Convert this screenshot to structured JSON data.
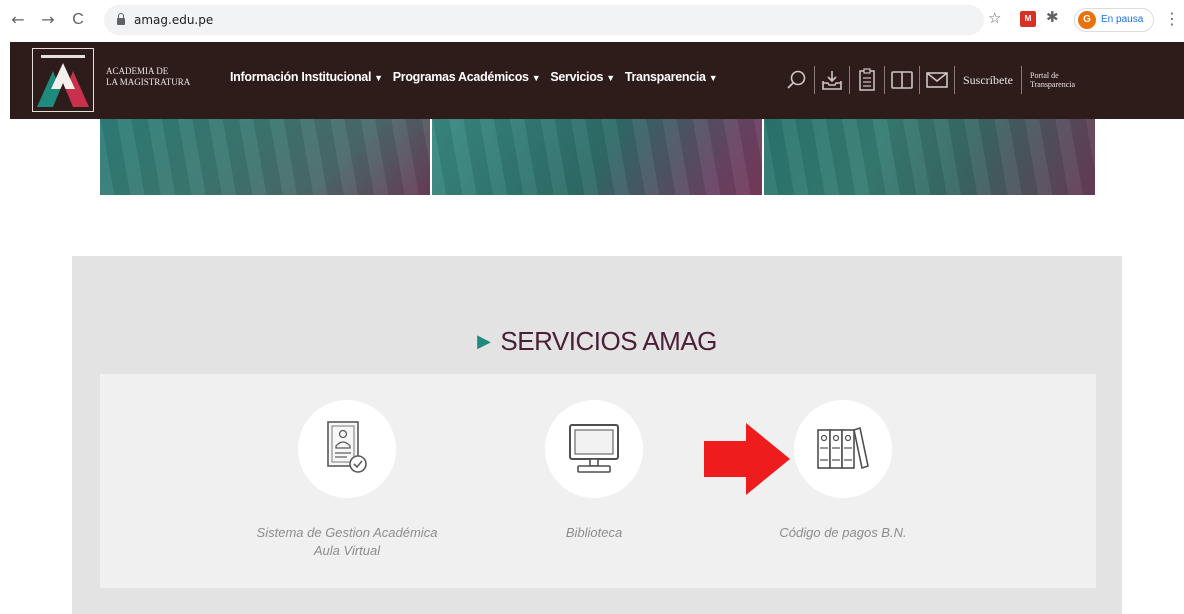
{
  "browser": {
    "url": "amag.edu.pe",
    "back_icon": "←",
    "forward_icon": "→",
    "reload_icon": "C",
    "profile_label": "En pausa",
    "profile_initial": "G",
    "extension_label": "M",
    "menu_icon": "⋮"
  },
  "header": {
    "logo_line1": "ACADEMIA DE",
    "logo_line2": "LA MAGISTRATURA",
    "nav": [
      {
        "label": "Información Institucional"
      },
      {
        "label": "Programas Académicos"
      },
      {
        "label": "Servicios"
      },
      {
        "label": "Transparencia"
      }
    ],
    "caret": "▼",
    "subscribe_label": "Suscríbete",
    "portal_line1": "Portal de",
    "portal_line2": "Transparencia"
  },
  "services": {
    "title": "SERVICIOS AMAG",
    "title_marker": "▶",
    "items": [
      {
        "line1": "Sistema de Gestion Académica",
        "line2": "Aula Virtual"
      },
      {
        "line1": "Biblioteca",
        "line2": ""
      },
      {
        "line1": "Código de pagos B.N.",
        "line2": ""
      }
    ]
  },
  "colors": {
    "header_bg": "#2d1c1a",
    "title_color": "#4a1e36",
    "accent_teal": "#1f8a7e",
    "arrow_red": "#ee1c1c"
  }
}
